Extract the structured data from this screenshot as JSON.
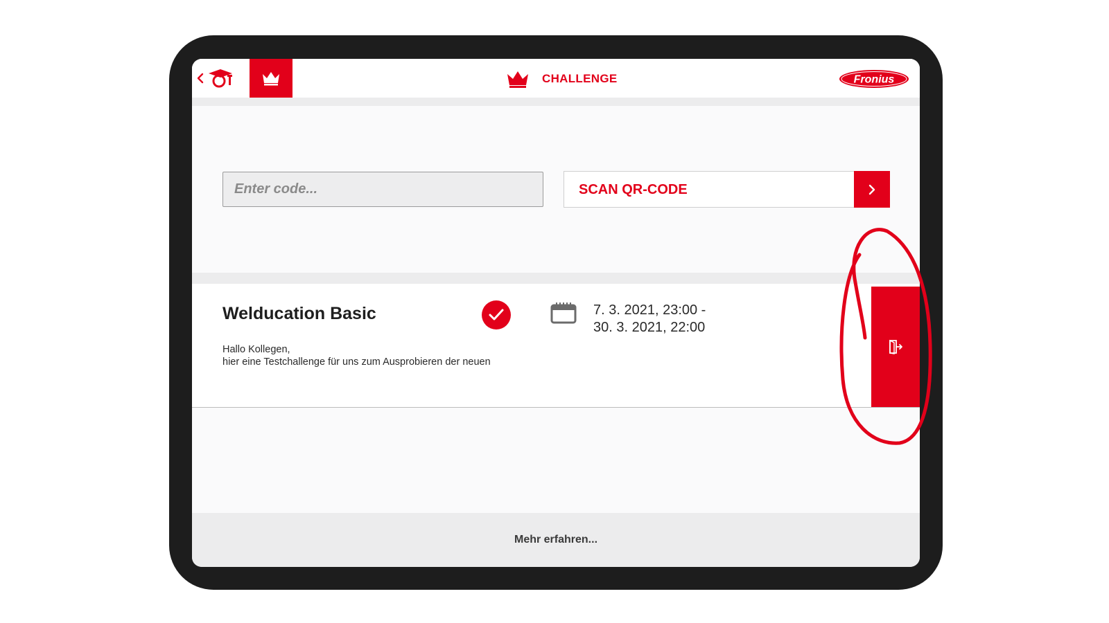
{
  "header": {
    "title": "CHALLENGE",
    "logo_text": "Fronius"
  },
  "icons": {
    "back": "chevron-left-icon",
    "academy": "graduation-cap-icon",
    "crown": "crown-icon",
    "scan_arrow": "chevron-right-icon",
    "check": "checkmark-icon",
    "calendar": "calendar-icon",
    "enter": "door-enter-icon"
  },
  "code_entry": {
    "placeholder": "Enter code...",
    "value": "",
    "scan_label": "SCAN QR-CODE"
  },
  "challenge": {
    "title": "Welducation Basic",
    "completed": true,
    "date_line_1": "7. 3. 2021, 23:00 -",
    "date_line_2": "30. 3. 2021, 22:00",
    "description_line_1": "Hallo Kollegen,",
    "description_line_2": "hier eine Testchallenge für uns zum Ausprobieren der neuen"
  },
  "footer": {
    "link_label": "Mehr erfahren..."
  },
  "colors": {
    "brand_red": "#e2001a",
    "tablet_frame": "#1d1d1d",
    "divider_gray": "#ececed"
  }
}
